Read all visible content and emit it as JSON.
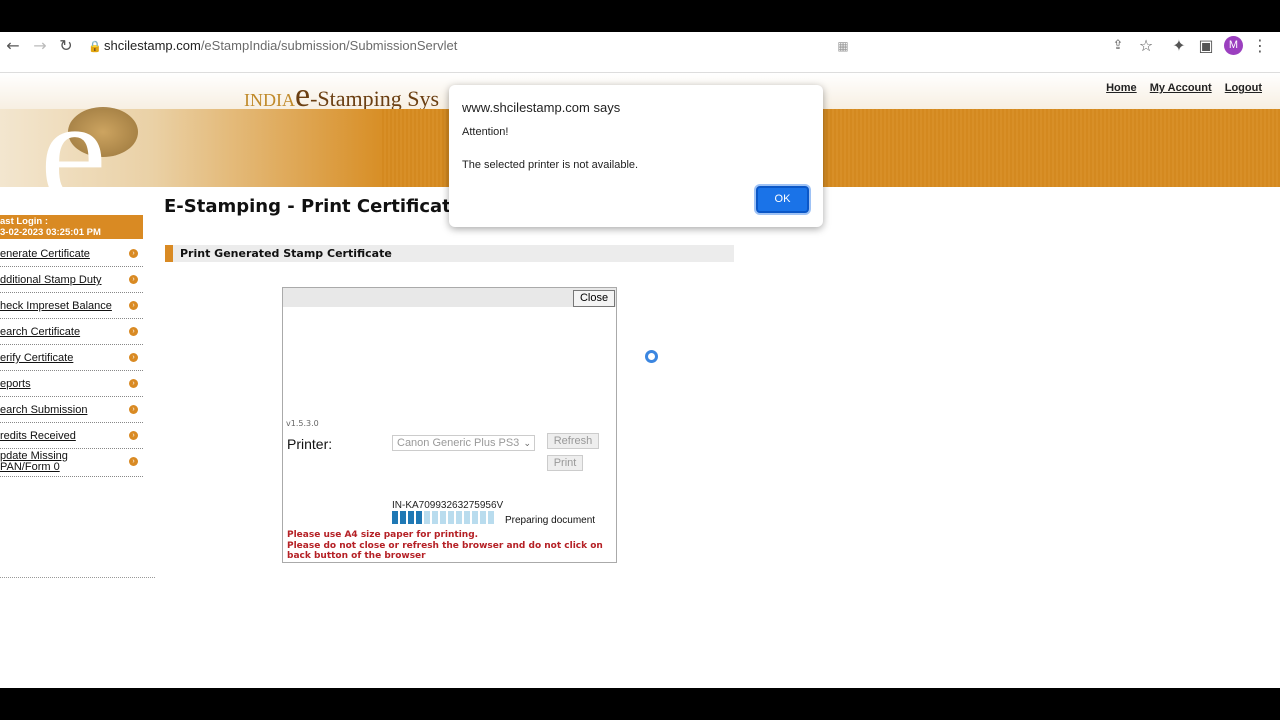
{
  "browser": {
    "url_domain": "shcilestamp.com",
    "url_path": "/eStampIndia/submission/SubmissionServlet",
    "avatar_letter": "M"
  },
  "header": {
    "logo_prefix": "INDIA",
    "logo_e": "e",
    "logo_rest": "-Stamping Sys",
    "links": [
      "Home",
      "My Account",
      "Logout"
    ]
  },
  "sidebar": {
    "last_login_label": "ast Login :",
    "last_login_value": "3-02-2023 03:25:01 PM",
    "items": [
      {
        "label": "enerate Certificate"
      },
      {
        "label": "dditional Stamp Duty"
      },
      {
        "label": "heck Impreset Balance"
      },
      {
        "label": "earch Certificate"
      },
      {
        "label": "erify Certificate"
      },
      {
        "label": "eports"
      },
      {
        "label": "earch Submission"
      },
      {
        "label": "redits Received"
      },
      {
        "label": "pdate Missing PAN/Form 0"
      }
    ]
  },
  "main": {
    "title": "E-Stamping - Print Certificate",
    "section": "Print Generated Stamp Certificate"
  },
  "print_box": {
    "close_label": "Close",
    "version": "v1.5.3.0",
    "printer_label": "Printer:",
    "printer_selected": "Canon Generic Plus PS3",
    "refresh_label": "Refresh",
    "print_label": "Print",
    "doc_id": "IN-KA70993263275956V",
    "status": "Preparing document",
    "progress_fraction": 0.3,
    "warning_1": "Please use A4 size paper for printing.",
    "warning_2": "Please do not close or refresh the browser and do not click on back button of the browser"
  },
  "dialog": {
    "title": "www.shcilestamp.com says",
    "message_1": "Attention!",
    "message_2": "The selected printer is not available.",
    "ok_label": "OK",
    "ok_color": "#1a73e8"
  },
  "colors": {
    "brand_orange": "#d98a23",
    "warning_red": "#b52025"
  }
}
